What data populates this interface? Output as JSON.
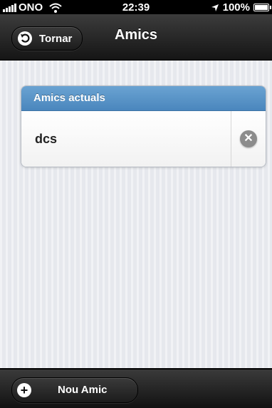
{
  "status_bar": {
    "carrier": "ONO",
    "time": "22:39",
    "battery": "100%",
    "battery_level": 1.0
  },
  "navbar": {
    "back_label": "Tornar",
    "title": "Amics"
  },
  "friends_list": {
    "header": "Amics actuals",
    "items": [
      {
        "label": "dcs"
      }
    ]
  },
  "toolbar": {
    "add_label": "Nou Amic"
  },
  "colors": {
    "list_header": "#4a86bd",
    "background": "#e6e8ed",
    "bar": "#1c1c1c"
  }
}
